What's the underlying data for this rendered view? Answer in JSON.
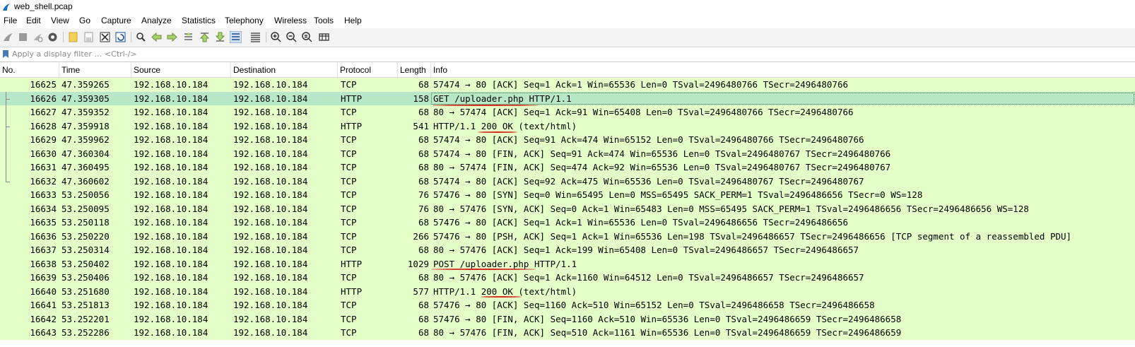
{
  "window": {
    "title": "web_shell.pcap"
  },
  "menu": [
    "File",
    "Edit",
    "View",
    "Go",
    "Capture",
    "Analyze",
    "Statistics",
    "Telephony",
    "Wireless",
    "Tools",
    "Help"
  ],
  "toolbar_icons": [
    "start-capture-icon",
    "stop-capture-icon",
    "restart-capture-icon",
    "capture-options-icon",
    "open-file-icon",
    "save-file-icon",
    "close-file-icon",
    "reload-file-icon",
    "find-packet-icon",
    "go-back-icon",
    "go-forward-icon",
    "go-to-packet-icon",
    "first-packet-icon",
    "last-packet-icon",
    "auto-scroll-icon",
    "colorize-icon",
    "zoom-in-icon",
    "zoom-out-icon",
    "normal-size-icon",
    "resize-columns-icon"
  ],
  "filter": {
    "placeholder": "Apply a display filter … <Ctrl-/>"
  },
  "columns": [
    "No.",
    "Time",
    "Source",
    "Destination",
    "Protocol",
    "Length",
    "Info"
  ],
  "packets": [
    {
      "no": "16625",
      "time": "47.359265",
      "src": "192.168.10.184",
      "dst": "192.168.10.184",
      "proto": "TCP",
      "len": "68",
      "info": "57474 → 80 [ACK] Seq=1 Ack=1 Win=65536 Len=0 TSval=2496480766 TSecr=2496480766"
    },
    {
      "no": "16626",
      "time": "47.359305",
      "src": "192.168.10.184",
      "dst": "192.168.10.184",
      "proto": "HTTP",
      "len": "158",
      "info": "GET /uploader.php HTTP/1.1"
    },
    {
      "no": "16627",
      "time": "47.359352",
      "src": "192.168.10.184",
      "dst": "192.168.10.184",
      "proto": "TCP",
      "len": "68",
      "info": "80 → 57474 [ACK] Seq=1 Ack=91 Win=65408 Len=0 TSval=2496480766 TSecr=2496480766"
    },
    {
      "no": "16628",
      "time": "47.359918",
      "src": "192.168.10.184",
      "dst": "192.168.10.184",
      "proto": "HTTP",
      "len": "541",
      "info": "HTTP/1.1 200 OK  (text/html)"
    },
    {
      "no": "16629",
      "time": "47.359962",
      "src": "192.168.10.184",
      "dst": "192.168.10.184",
      "proto": "TCP",
      "len": "68",
      "info": "57474 → 80 [ACK] Seq=91 Ack=474 Win=65152 Len=0 TSval=2496480766 TSecr=2496480766"
    },
    {
      "no": "16630",
      "time": "47.360304",
      "src": "192.168.10.184",
      "dst": "192.168.10.184",
      "proto": "TCP",
      "len": "68",
      "info": "57474 → 80 [FIN, ACK] Seq=91 Ack=474 Win=65536 Len=0 TSval=2496480767 TSecr=2496480766"
    },
    {
      "no": "16631",
      "time": "47.360495",
      "src": "192.168.10.184",
      "dst": "192.168.10.184",
      "proto": "TCP",
      "len": "68",
      "info": "80 → 57474 [FIN, ACK] Seq=474 Ack=92 Win=65536 Len=0 TSval=2496480767 TSecr=2496480767"
    },
    {
      "no": "16632",
      "time": "47.360602",
      "src": "192.168.10.184",
      "dst": "192.168.10.184",
      "proto": "TCP",
      "len": "68",
      "info": "57474 → 80 [ACK] Seq=92 Ack=475 Win=65536 Len=0 TSval=2496480767 TSecr=2496480767"
    },
    {
      "no": "16633",
      "time": "53.250056",
      "src": "192.168.10.184",
      "dst": "192.168.10.184",
      "proto": "TCP",
      "len": "76",
      "info": "57476 → 80 [SYN] Seq=0 Win=65495 Len=0 MSS=65495 SACK_PERM=1 TSval=2496486656 TSecr=0 WS=128"
    },
    {
      "no": "16634",
      "time": "53.250095",
      "src": "192.168.10.184",
      "dst": "192.168.10.184",
      "proto": "TCP",
      "len": "76",
      "info": "80 → 57476 [SYN, ACK] Seq=0 Ack=1 Win=65483 Len=0 MSS=65495 SACK_PERM=1 TSval=2496486656 TSecr=2496486656 WS=128"
    },
    {
      "no": "16635",
      "time": "53.250118",
      "src": "192.168.10.184",
      "dst": "192.168.10.184",
      "proto": "TCP",
      "len": "68",
      "info": "57476 → 80 [ACK] Seq=1 Ack=1 Win=65536 Len=0 TSval=2496486656 TSecr=2496486656"
    },
    {
      "no": "16636",
      "time": "53.250220",
      "src": "192.168.10.184",
      "dst": "192.168.10.184",
      "proto": "TCP",
      "len": "266",
      "info": "57476 → 80 [PSH, ACK] Seq=1 Ack=1 Win=65536 Len=198 TSval=2496486657 TSecr=2496486656 [TCP segment of a reassembled PDU]"
    },
    {
      "no": "16637",
      "time": "53.250314",
      "src": "192.168.10.184",
      "dst": "192.168.10.184",
      "proto": "TCP",
      "len": "68",
      "info": "80 → 57476 [ACK] Seq=1 Ack=199 Win=65408 Len=0 TSval=2496486657 TSecr=2496486657"
    },
    {
      "no": "16638",
      "time": "53.250402",
      "src": "192.168.10.184",
      "dst": "192.168.10.184",
      "proto": "HTTP",
      "len": "1029",
      "info": "POST /uploader.php HTTP/1.1"
    },
    {
      "no": "16639",
      "time": "53.250406",
      "src": "192.168.10.184",
      "dst": "192.168.10.184",
      "proto": "TCP",
      "len": "68",
      "info": "80 → 57476 [ACK] Seq=1 Ack=1160 Win=64512 Len=0 TSval=2496486657 TSecr=2496486657"
    },
    {
      "no": "16640",
      "time": "53.251680",
      "src": "192.168.10.184",
      "dst": "192.168.10.184",
      "proto": "HTTP",
      "len": "577",
      "info": "HTTP/1.1 200 OK  (text/html)"
    },
    {
      "no": "16641",
      "time": "53.251813",
      "src": "192.168.10.184",
      "dst": "192.168.10.184",
      "proto": "TCP",
      "len": "68",
      "info": "57476 → 80 [ACK] Seq=1160 Ack=510 Win=65152 Len=0 TSval=2496486658 TSecr=2496486658"
    },
    {
      "no": "16642",
      "time": "53.252201",
      "src": "192.168.10.184",
      "dst": "192.168.10.184",
      "proto": "TCP",
      "len": "68",
      "info": "57476 → 80 [FIN, ACK] Seq=1160 Ack=510 Win=65536 Len=0 TSval=2496486659 TSecr=2496486658"
    },
    {
      "no": "16643",
      "time": "53.252286",
      "src": "192.168.10.184",
      "dst": "192.168.10.184",
      "proto": "TCP",
      "len": "68",
      "info": "80 → 57476 [FIN, ACK] Seq=510 Ack=1161 Win=65536 Len=0 TSval=2496486659 TSecr=2496486659"
    }
  ],
  "selected_packet": "16626",
  "colors": {
    "tcp_row": "#e4ffc7",
    "selected_row": "#b9e8c9",
    "annotation": "#d42a1f"
  }
}
